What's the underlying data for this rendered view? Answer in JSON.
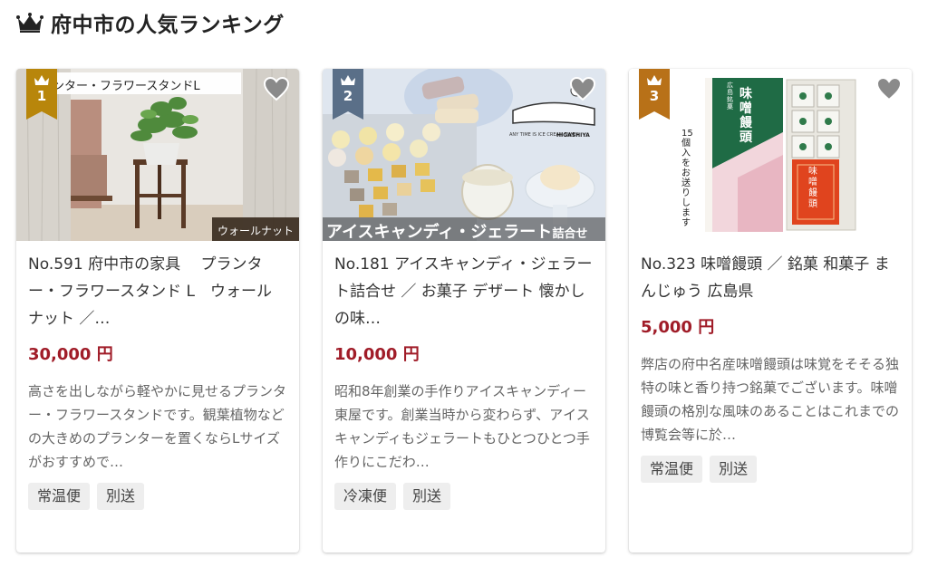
{
  "page": {
    "title": "府中市の人気ランキング",
    "crown_icon": "crown-icon",
    "badge_colors": {
      "1": "#b8860b",
      "2": "#5a6f88",
      "3": "#b87118"
    }
  },
  "cards": [
    {
      "rank": "1",
      "image_text": {
        "top": "ンター・フラワースタンドL",
        "bottom": "ウォールナット"
      },
      "name": "No.591 府中市の家具　 プランター・フラワースタンド L　ウォールナット ／…",
      "price": "30,000 円",
      "description": "高さを出しながら軽やかに見せるプランター・フラワースタンドです。観葉植物などの大きめのプランターを置くならLサイズがおすすめで…",
      "tags": [
        "常温便",
        "別送"
      ]
    },
    {
      "rank": "2",
      "image_text": {
        "banner": "アイスキャンディ・ジェラート",
        "banner_small": "詰合せ",
        "label": "HIGASHIYA",
        "tagline": "ANY TIME IS ICE CREAM TIME!!"
      },
      "name": "No.181 アイスキャンディ・ジェラート詰合せ ／ お菓子 デザート 懐かしの味…",
      "price": "10,000 円",
      "description": "昭和8年創業の手作りアイスキャンディー東屋です。創業当時から変わらず、アイスキャンディもジェラートもひとつひとつ手作りにこだわ…",
      "tags": [
        "冷凍便",
        "別送"
      ]
    },
    {
      "rank": "3",
      "image_text": {
        "box_title": "味噌饅頭",
        "box_sub": "広島銘菓",
        "note": "15個入をお送りします",
        "inner": "味噌饅頭"
      },
      "name": "No.323 味噌饅頭 ／ 銘菓 和菓子 まんじゅう 広島県",
      "price": "5,000 円",
      "description": "弊店の府中名産味噌饅頭は味覚をそそる独特の味と香り持つ銘菓でございます。味噌饅頭の格別な風味のあることはこれまでの博覧会等に於…",
      "tags": [
        "常温便",
        "別送"
      ]
    }
  ]
}
